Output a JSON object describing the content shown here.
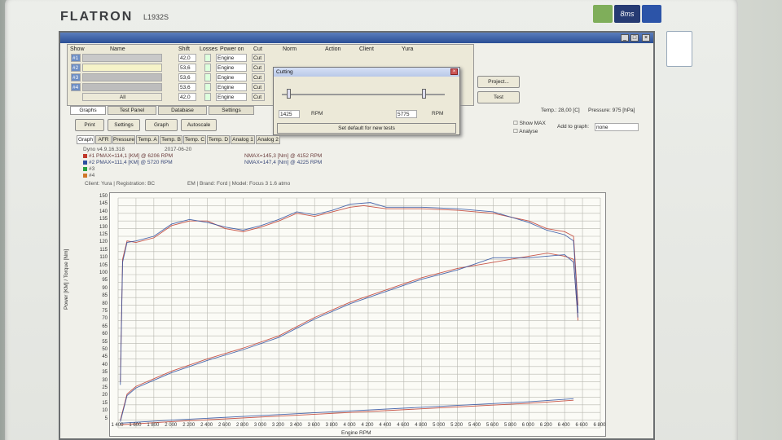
{
  "monitor": {
    "brand": "FLATRON",
    "model": "L1932S",
    "sticker_ms": "8ms"
  },
  "colors": {
    "accent": "#2b4f95",
    "series1": "#c0392b",
    "series2": "#2c4fa0",
    "series3": "#27a040",
    "series4": "#d0772a"
  },
  "window": {
    "columns": {
      "show": "Show",
      "name": "Name",
      "shift": "Shift",
      "losses": "Losses",
      "power_on": "Power on",
      "cut": "Cut",
      "norm": "Norm",
      "action": "Action",
      "client": "Client",
      "client_value": "Yura"
    },
    "rows": [
      {
        "id": "#1",
        "shift": "42,0",
        "power_on": "Engine",
        "cut": "Cut"
      },
      {
        "id": "#2",
        "shift": "53,6",
        "power_on": "Engine",
        "cut": "Cut"
      },
      {
        "id": "#3",
        "shift": "53,6",
        "power_on": "Engine",
        "cut": "Cut"
      },
      {
        "id": "#4",
        "shift": "53,6",
        "power_on": "Engine",
        "cut": "Cut"
      },
      {
        "id": "All",
        "shift": "42,0",
        "power_on": "Engine",
        "cut": "Cut"
      }
    ],
    "project_button": "Project...",
    "test_button": "Test"
  },
  "cutting_dialog": {
    "title": "Cutting",
    "rpm_low": "1425",
    "rpm_high": "5775",
    "rpm_unit": "RPM",
    "default_button": "Set default for new tests"
  },
  "tabs": [
    "Graphs",
    "Test Panel",
    "Database",
    "Settings"
  ],
  "status": {
    "temp": "Temp.: 28,00 [C]",
    "pressure": "Pressure: 975 [hPa]"
  },
  "toolbar": {
    "print": "Print",
    "settings": "Settings",
    "graph": "Graph",
    "autoscale": "Autoscale",
    "show_max": "Show MAX",
    "analyse": "Analyse",
    "add_to_graph": "Add to graph:",
    "add_value": "none"
  },
  "subtabs": [
    "Graph",
    "AFR",
    "Pressure",
    "Temp. A",
    "Temp. B",
    "Temp. C",
    "Temp. D",
    "Analog 1",
    "Analog 2"
  ],
  "info": {
    "version": "Dyno v4.9.16.318",
    "date": "2017-06-20",
    "l1": "#1 PMAX=114,1 [KM] @ 6206 RPM",
    "r1": "NMAX=145,3 [Nm] @ 4152 RPM",
    "l2": "#2 PMAX=111,4 [KM] @ 5720 RPM",
    "r2": "NMAX=147,4 [Nm] @ 4225 RPM",
    "l3": "#3",
    "l4": "#4",
    "client": "Client: Yura | Registration: BC",
    "em": "EM | Brand: Ford | Model: Focus 3 1.6 atmo"
  },
  "chart_data": {
    "type": "line",
    "xlabel": "Engine RPM",
    "ylabel": "Power [KM] / Torque [Nm]",
    "xlim": [
      1400,
      6800
    ],
    "ylim": [
      0,
      150
    ],
    "x_ticks": [
      "1 400",
      "1 600",
      "1 800",
      "2 000",
      "2 200",
      "2 400",
      "2 600",
      "2 800",
      "3 000",
      "3 200",
      "3 400",
      "3 600",
      "3 800",
      "4 000",
      "4 200",
      "4 400",
      "4 600",
      "4 800",
      "5 000",
      "5 200",
      "5 400",
      "5 600",
      "5 800",
      "6 000",
      "6 200",
      "6 400",
      "6 600",
      "6 800"
    ],
    "y_ticks": [
      0,
      5,
      10,
      15,
      20,
      25,
      30,
      35,
      40,
      45,
      50,
      55,
      60,
      65,
      70,
      75,
      80,
      85,
      90,
      95,
      100,
      105,
      110,
      115,
      120,
      125,
      130,
      135,
      140,
      145,
      150
    ],
    "grid": true,
    "series": [
      {
        "name": "#1 torque",
        "x": [
          1425,
          1450,
          1500,
          1600,
          1800,
          2000,
          2200,
          2400,
          2600,
          2800,
          3000,
          3200,
          3400,
          3600,
          3800,
          4000,
          4150,
          4400,
          4800,
          5200,
          5600,
          6000,
          6200,
          6400,
          6500,
          6550
        ],
        "y": [
          30,
          110,
          122,
          121,
          124,
          132,
          135,
          135,
          130,
          128,
          131,
          135,
          140,
          138,
          141,
          144,
          145,
          143,
          143,
          142,
          140,
          135,
          130,
          128,
          125,
          80
        ]
      },
      {
        "name": "#2 torque",
        "x": [
          1425,
          1450,
          1500,
          1600,
          1800,
          2000,
          2200,
          2400,
          2600,
          2800,
          3000,
          3200,
          3400,
          3600,
          3800,
          4000,
          4225,
          4400,
          4800,
          5200,
          5600,
          6000,
          6200,
          6400,
          6500,
          6550
        ],
        "y": [
          28,
          108,
          121,
          122,
          125,
          133,
          136,
          134,
          131,
          129,
          132,
          136,
          141,
          139,
          142,
          146,
          147,
          144,
          144,
          143,
          141,
          134,
          129,
          126,
          122,
          75
        ]
      },
      {
        "name": "#1 power",
        "x": [
          1425,
          1500,
          1600,
          1800,
          2000,
          2400,
          2800,
          3200,
          3600,
          4000,
          4400,
          4800,
          5200,
          5600,
          6000,
          6206,
          6400,
          6500,
          6550
        ],
        "y": [
          5,
          22,
          27,
          32,
          37,
          45,
          52,
          60,
          72,
          82,
          90,
          98,
          104,
          108,
          112,
          114,
          112,
          110,
          70
        ]
      },
      {
        "name": "#2 power",
        "x": [
          1425,
          1500,
          1600,
          1800,
          2000,
          2400,
          2800,
          3200,
          3600,
          4000,
          4400,
          4800,
          5200,
          5600,
          5720,
          6000,
          6400,
          6500,
          6550
        ],
        "y": [
          4,
          21,
          26,
          31,
          36,
          44,
          51,
          59,
          71,
          81,
          89,
          97,
          103,
          111,
          111,
          111,
          113,
          108,
          72
        ]
      },
      {
        "name": "#1 losses",
        "x": [
          1425,
          2000,
          3000,
          4000,
          5000,
          6000,
          6500
        ],
        "y": [
          2,
          4,
          7,
          10,
          13,
          16,
          18
        ]
      },
      {
        "name": "#2 losses",
        "x": [
          1425,
          2000,
          3000,
          4000,
          5000,
          6000,
          6500
        ],
        "y": [
          3,
          5,
          8,
          11,
          14,
          17,
          19
        ]
      }
    ]
  }
}
